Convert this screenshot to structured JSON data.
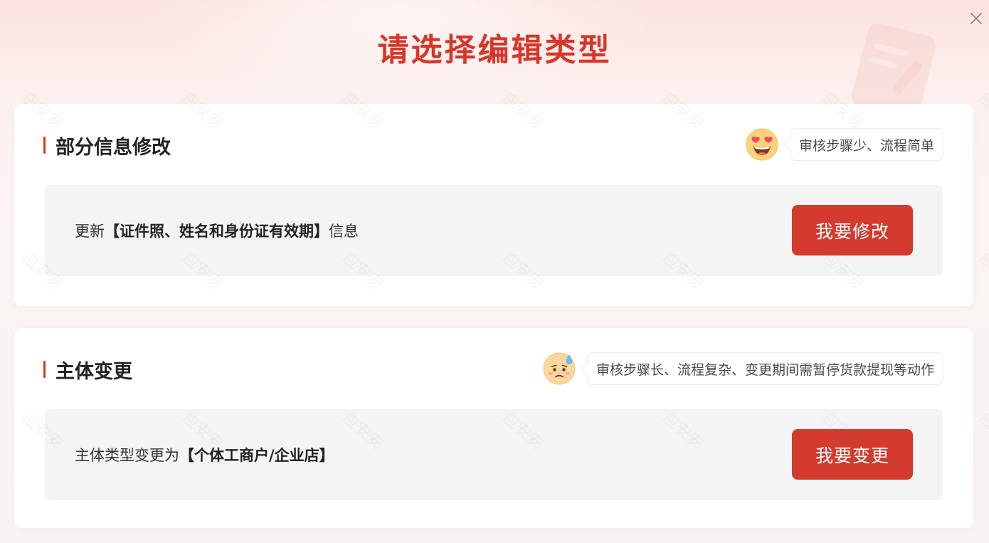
{
  "title": "请选择编辑类型",
  "accent_color": "#d23b2e",
  "close_icon": "close-icon",
  "sections": [
    {
      "title": "部分信息修改",
      "emoji_icon": "heart-eyes-emoji-icon",
      "hint": "审核步骤少、流程简单",
      "desc_prefix": "更新",
      "desc_highlight": "【证件照、姓名和身份证有效期】",
      "desc_suffix": "信息",
      "button_label": "我要修改"
    },
    {
      "title": "主体变更",
      "emoji_icon": "sweat-frown-emoji-icon",
      "hint": "审核步骤长、流程复杂、变更期间需暂停货款提现等动作",
      "desc_prefix": "主体类型变更为",
      "desc_highlight": "【个体工商户/企业店】",
      "desc_suffix": "",
      "button_label": "我要变更"
    }
  ],
  "watermark_text": "应安安"
}
